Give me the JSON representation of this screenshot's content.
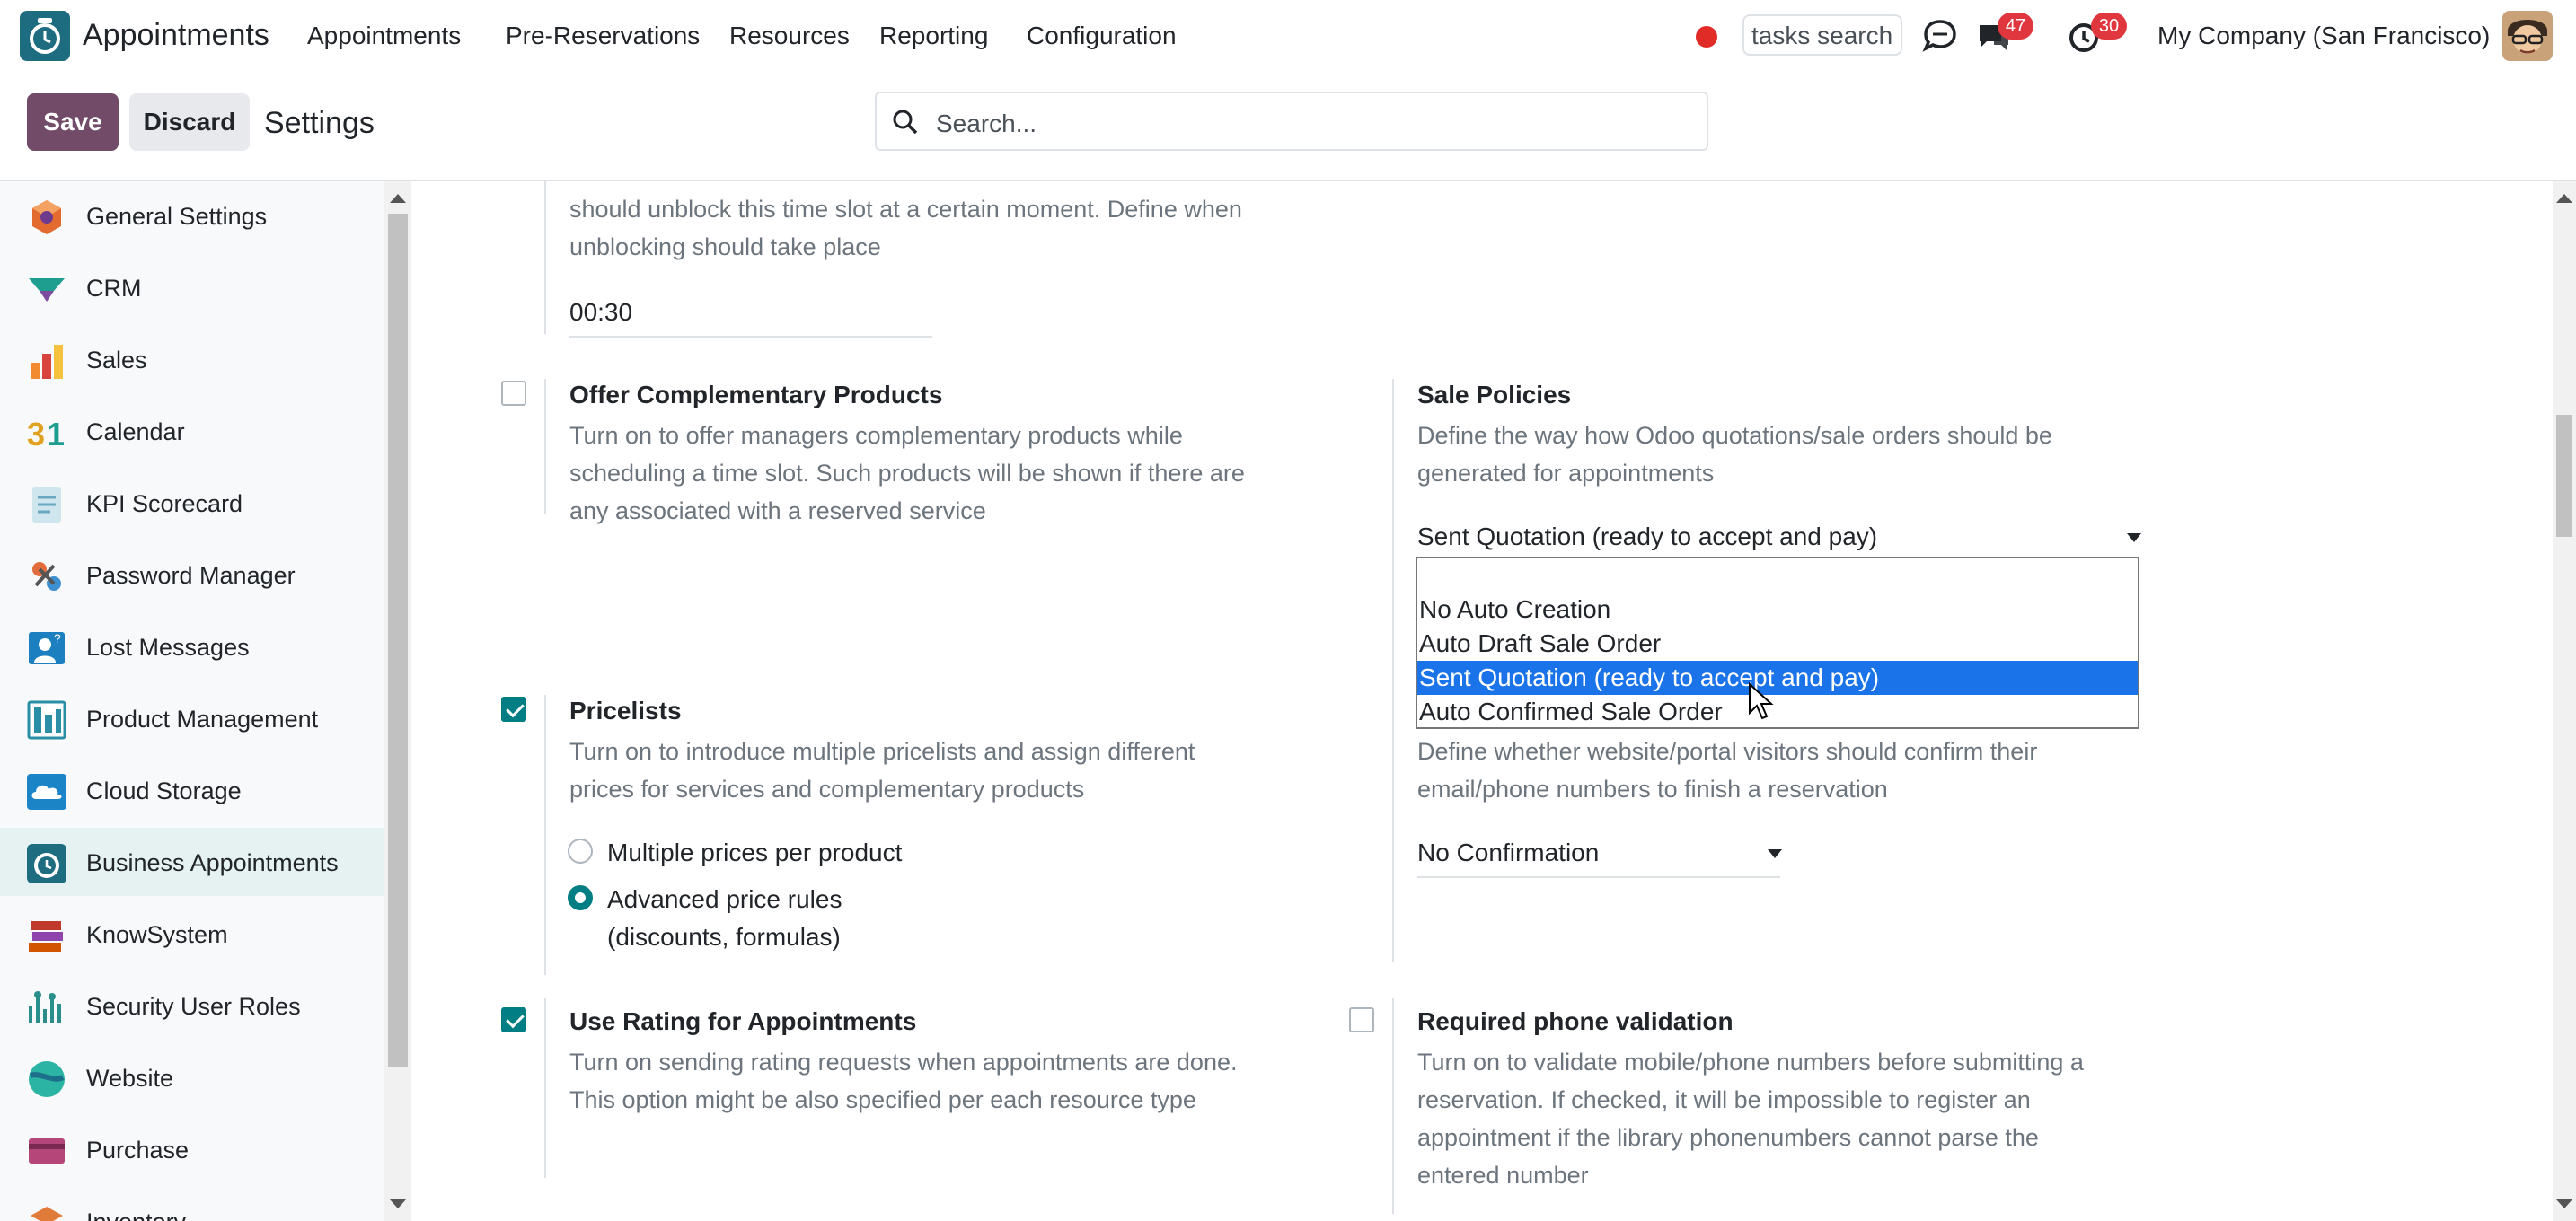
{
  "navbar": {
    "app_name": "Appointments",
    "menu": [
      "Appointments",
      "Pre-Reservations",
      "Resources",
      "Reporting",
      "Configuration"
    ],
    "tasks_search": "tasks search",
    "messages_badge": "47",
    "activities_badge": "30",
    "company": "My Company (San Francisco)"
  },
  "control_panel": {
    "save_label": "Save",
    "discard_label": "Discard",
    "breadcrumb": "Settings",
    "search_placeholder": "Search..."
  },
  "sidebar": {
    "items": [
      {
        "label": "General Settings",
        "icon": "general-settings-icon"
      },
      {
        "label": "CRM",
        "icon": "crm-icon"
      },
      {
        "label": "Sales",
        "icon": "sales-icon"
      },
      {
        "label": "Calendar",
        "icon": "calendar-icon"
      },
      {
        "label": "KPI Scorecard",
        "icon": "kpi-scorecard-icon"
      },
      {
        "label": "Password Manager",
        "icon": "password-manager-icon"
      },
      {
        "label": "Lost Messages",
        "icon": "lost-messages-icon"
      },
      {
        "label": "Product Management",
        "icon": "product-management-icon"
      },
      {
        "label": "Cloud Storage",
        "icon": "cloud-storage-icon"
      },
      {
        "label": "Business Appointments",
        "icon": "business-appointments-icon",
        "active": true
      },
      {
        "label": "KnowSystem",
        "icon": "knowsystem-icon"
      },
      {
        "label": "Security User Roles",
        "icon": "security-user-roles-icon"
      },
      {
        "label": "Website",
        "icon": "website-icon"
      },
      {
        "label": "Purchase",
        "icon": "purchase-icon"
      },
      {
        "label": "Inventory",
        "icon": "inventory-icon"
      }
    ]
  },
  "settings": {
    "unblock": {
      "desc_top": "should unblock this time slot at a certain moment. Define when",
      "desc_bottom": "unblocking should take place",
      "value": "00:30"
    },
    "complementary": {
      "title": "Offer Complementary Products",
      "desc": [
        "Turn on to offer managers complementary products while",
        "scheduling a time slot. Such products will be shown if there are",
        "any associated with a reserved service"
      ],
      "checked": false
    },
    "sale_policies": {
      "title": "Sale Policies",
      "desc": [
        "Define the way how Odoo quotations/sale orders should be",
        "generated for appointments"
      ],
      "value": "Sent Quotation (ready to accept and pay)",
      "options": [
        "",
        "No Auto Creation",
        "Auto Draft Sale Order",
        "Sent Quotation (ready to accept and pay)",
        "Auto Confirmed Sale Order"
      ],
      "selected_index": 3
    },
    "pricelists": {
      "title": "Pricelists",
      "desc": [
        "Turn on to introduce multiple pricelists and assign different",
        "prices for services and complementary products"
      ],
      "checked": true,
      "radio_options": [
        "Multiple prices per product",
        "Advanced price rules",
        "(discounts, formulas)"
      ],
      "radio_selected": 1
    },
    "confirmation": {
      "desc": [
        "Define whether website/portal visitors should confirm their",
        "email/phone numbers to finish a reservation"
      ],
      "value": "No Confirmation"
    },
    "rating": {
      "title": "Use Rating for Appointments",
      "desc": [
        "Turn on sending rating requests when appointments are done.",
        "This option might be also specified per each resource type"
      ],
      "checked": true
    },
    "phone_validation": {
      "title": "Required phone validation",
      "desc": [
        "Turn on to validate mobile/phone numbers before submitting a",
        "reservation. If checked, it will be impossible to register an",
        "appointment if the library phonenumbers cannot parse the",
        "entered number"
      ],
      "checked": false
    }
  },
  "colors": {
    "primary": "#714b67",
    "accent": "#017e84",
    "selected_option": "#1a73e8"
  }
}
